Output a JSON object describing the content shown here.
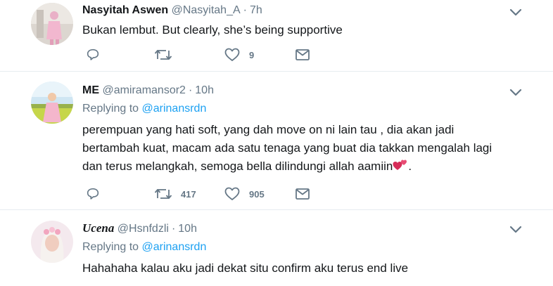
{
  "tweets": [
    {
      "name": "Nasyitah Aswen",
      "handle": "@Nasyitah_A",
      "separator": "·",
      "time": "7h",
      "text": "Bukan lembut. But clearly, she’s being supportive",
      "reply_count": "",
      "retweet_count": "",
      "like_count": "9"
    },
    {
      "name": "ME",
      "handle": "@amiramansor2",
      "separator": "·",
      "time": "10h",
      "replying_prefix": "Replying to",
      "replying_to": "@arinansrdn",
      "text_lines": [
        "perempuan yang hati soft, yang dah move on ni lain tau , dia akan jadi",
        "bertambah kuat, macam ada satu tenaga yang buat dia takkan mengalah lagi",
        "dan terus melangkah, semoga bella dilindungi allah aamiin"
      ],
      "text_end": ".",
      "reply_count": "",
      "retweet_count": "417",
      "like_count": "905"
    },
    {
      "name": "Ucena",
      "handle": "@Hsnfdzli",
      "separator": "·",
      "time": "10h",
      "replying_prefix": "Replying to",
      "replying_to": "@arinansrdn",
      "text": "Hahahaha kalau aku jadi dekat situ confirm aku terus end live"
    }
  ],
  "icons": {
    "reply": "reply-icon",
    "retweet": "retweet-icon",
    "like": "heart-icon",
    "dm": "envelope-icon",
    "more": "chevron-down-icon",
    "emoji": "two-hearts-emoji"
  },
  "colors": {
    "link": "#1da1f2",
    "secondary_text": "#657786",
    "divider": "#e6ecf0"
  }
}
